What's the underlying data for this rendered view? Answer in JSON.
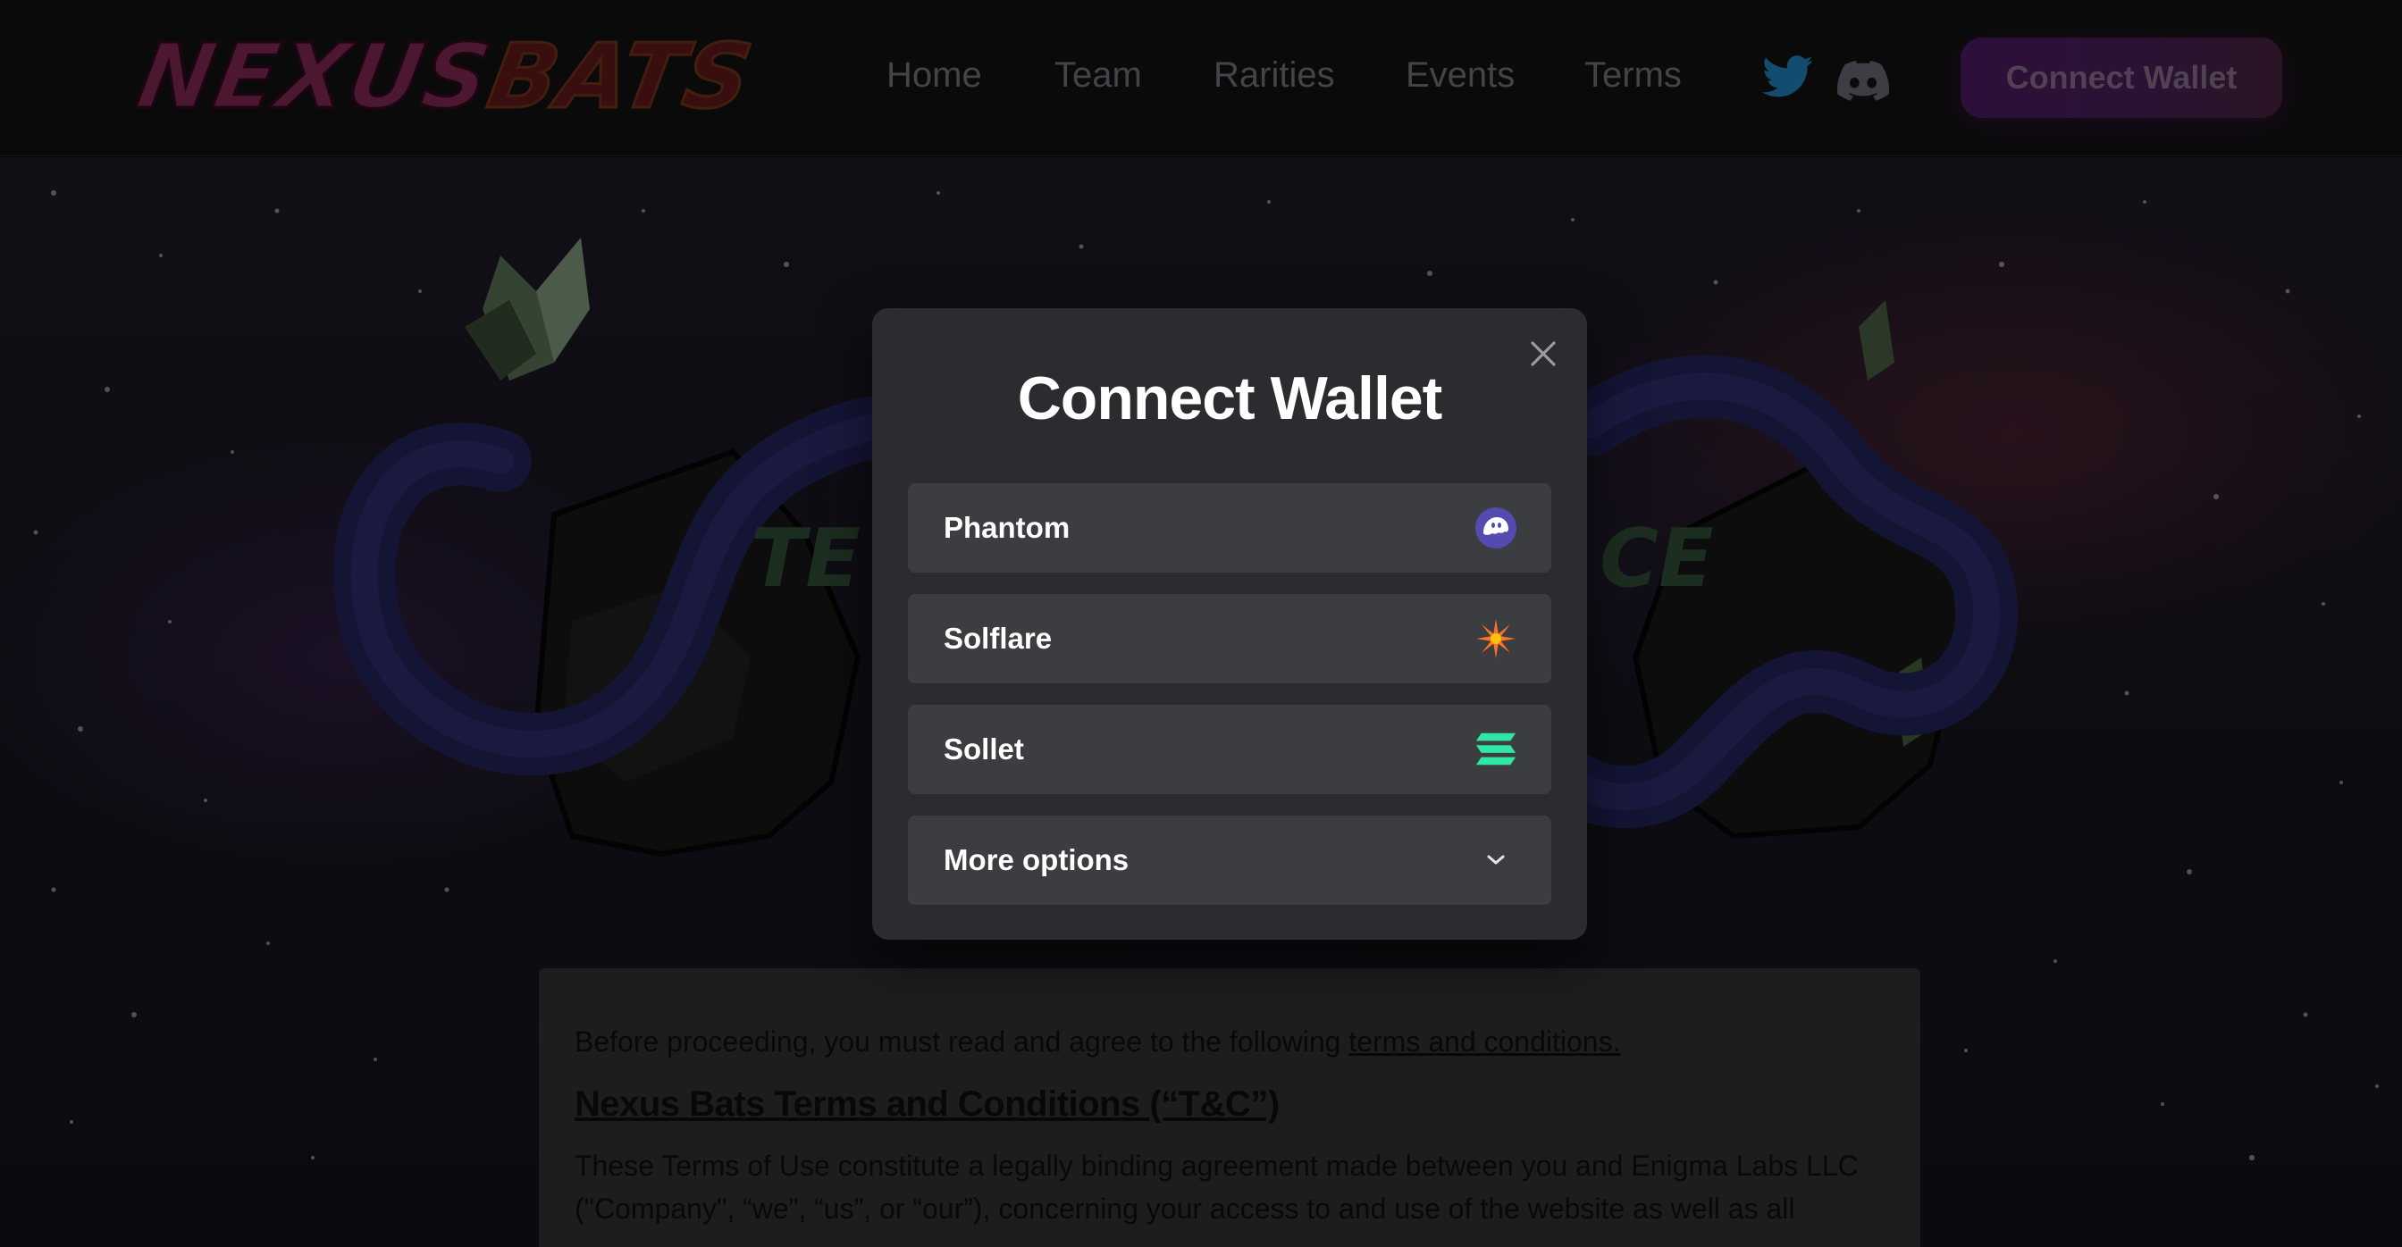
{
  "header": {
    "logo_part1": "NEXUS",
    "logo_part2": "BATS",
    "nav": [
      {
        "label": "Home"
      },
      {
        "label": "Team"
      },
      {
        "label": "Rarities"
      },
      {
        "label": "Events"
      },
      {
        "label": "Terms"
      }
    ],
    "social": [
      {
        "icon": "twitter-icon",
        "color": "#1d6a9a"
      },
      {
        "icon": "discord-icon",
        "color": "#55565d"
      }
    ],
    "connect_label": "Connect Wallet"
  },
  "modal": {
    "title": "Connect Wallet",
    "wallets": [
      {
        "name": "Phantom",
        "icon": "phantom-icon",
        "color": "#534bb1"
      },
      {
        "name": "Solflare",
        "icon": "solflare-icon",
        "color": "#fc7227"
      },
      {
        "name": "Sollet",
        "icon": "sollet-icon",
        "color": "#2ee6a6"
      }
    ],
    "more_options": "More options"
  },
  "terms": {
    "intro": "Before proceeding, you must read and agree to the following ",
    "intro_link": "terms and conditions.",
    "heading": "Nexus Bats Terms and Conditions (“T&C”)",
    "body": "These Terms of Use constitute a legally binding agreement made between you and Enigma Labs LLC (\"Company\", “we”, “us”, or “our”), concerning your access to and use of the website as well as all"
  },
  "colors": {
    "modal_bg": "#2b2c2f",
    "option_bg": "#3c3d40",
    "accent": "#7b2bbd"
  }
}
